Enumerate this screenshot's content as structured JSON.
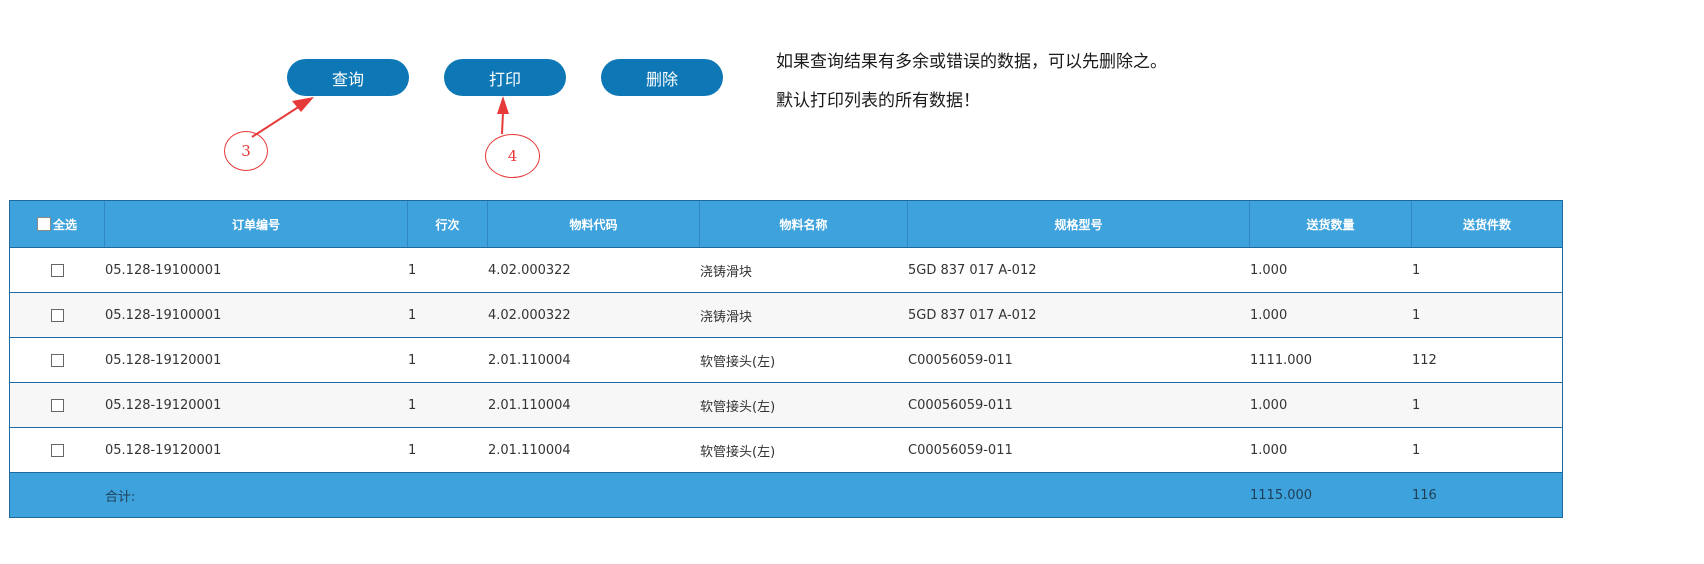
{
  "toolbar": {
    "query_label": "查询",
    "print_label": "打印",
    "delete_label": "删除"
  },
  "notes": {
    "line1": "如果查询结果有多余或错误的数据，可以先删除之。",
    "line2": "默认打印列表的所有数据！"
  },
  "callouts": {
    "query_step": "3",
    "print_step": "4"
  },
  "colors": {
    "button": "#0e78b6",
    "header": "#3ea2dd",
    "annotation": "#e63a3a"
  },
  "table": {
    "select_all_label": "全选",
    "columns": [
      "订单编号",
      "行次",
      "物料代码",
      "物料名称",
      "规格型号",
      "送货数量",
      "送货件数"
    ],
    "rows": [
      {
        "order_no": "05.128-19100001",
        "line": "1",
        "material_code": "4.02.000322",
        "material_name": "浇铸滑块",
        "spec": "5GD 837 017 A-012",
        "qty": "1.000",
        "pieces": "1"
      },
      {
        "order_no": "05.128-19100001",
        "line": "1",
        "material_code": "4.02.000322",
        "material_name": "浇铸滑块",
        "spec": "5GD 837 017 A-012",
        "qty": "1.000",
        "pieces": "1"
      },
      {
        "order_no": "05.128-19120001",
        "line": "1",
        "material_code": "2.01.110004",
        "material_name": "软管接头(左)",
        "spec": "C00056059-011",
        "qty": "1111.000",
        "pieces": "112"
      },
      {
        "order_no": "05.128-19120001",
        "line": "1",
        "material_code": "2.01.110004",
        "material_name": "软管接头(左)",
        "spec": "C00056059-011",
        "qty": "1.000",
        "pieces": "1"
      },
      {
        "order_no": "05.128-19120001",
        "line": "1",
        "material_code": "2.01.110004",
        "material_name": "软管接头(左)",
        "spec": "C00056059-011",
        "qty": "1.000",
        "pieces": "1"
      }
    ],
    "footer": {
      "label": "合计:",
      "qty_total": "1115.000",
      "pieces_total": "116"
    }
  }
}
